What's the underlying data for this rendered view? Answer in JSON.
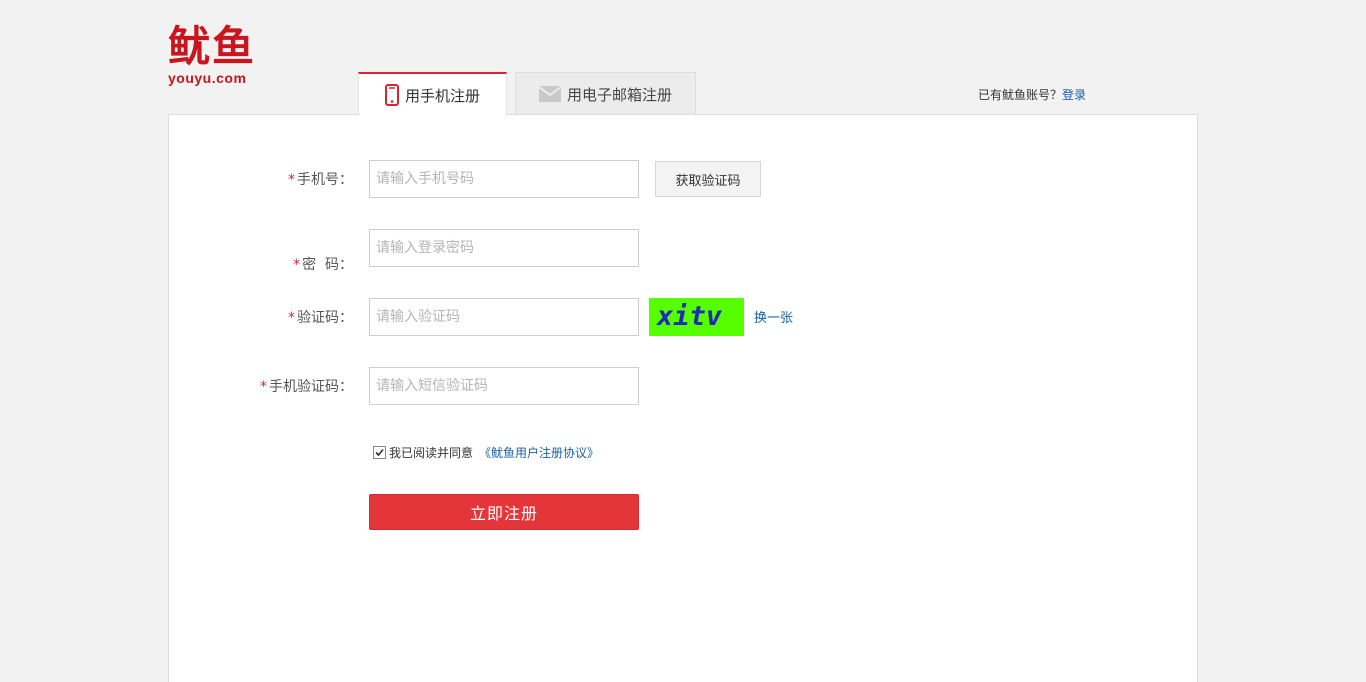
{
  "logo": {
    "cn": "鱿鱼",
    "en": "youyu.com"
  },
  "tabs": [
    {
      "label": "用手机注册",
      "active": true,
      "icon": "mobile-phone-icon"
    },
    {
      "label": "用电子邮箱注册",
      "active": false,
      "icon": "envelope-icon"
    }
  ],
  "login_hint": {
    "text": "已有鱿鱼账号？",
    "link": "登录"
  },
  "form": {
    "required_mark": "*",
    "phone": {
      "label": "手机号：",
      "placeholder": "请输入手机号码",
      "value": ""
    },
    "get_code_button": "获取验证码",
    "password": {
      "label": "密  码：",
      "placeholder": "请输入登录密码",
      "value": ""
    },
    "captcha": {
      "label": "验证码：",
      "placeholder": "请输入验证码",
      "value": "",
      "image_text": "xitv",
      "refresh": "换一张"
    },
    "sms_code": {
      "label": "手机验证码：",
      "placeholder": "请输入短信验证码",
      "value": ""
    },
    "agreement": {
      "text": "我已阅读并同意",
      "link": "《鱿鱼用户注册协议》",
      "checked": true
    },
    "submit": "立即注册"
  },
  "colors": {
    "brand": "#c9151e",
    "button": "#e3353a",
    "link": "#1a5fa8",
    "captcha_bg": "#55ff00"
  }
}
